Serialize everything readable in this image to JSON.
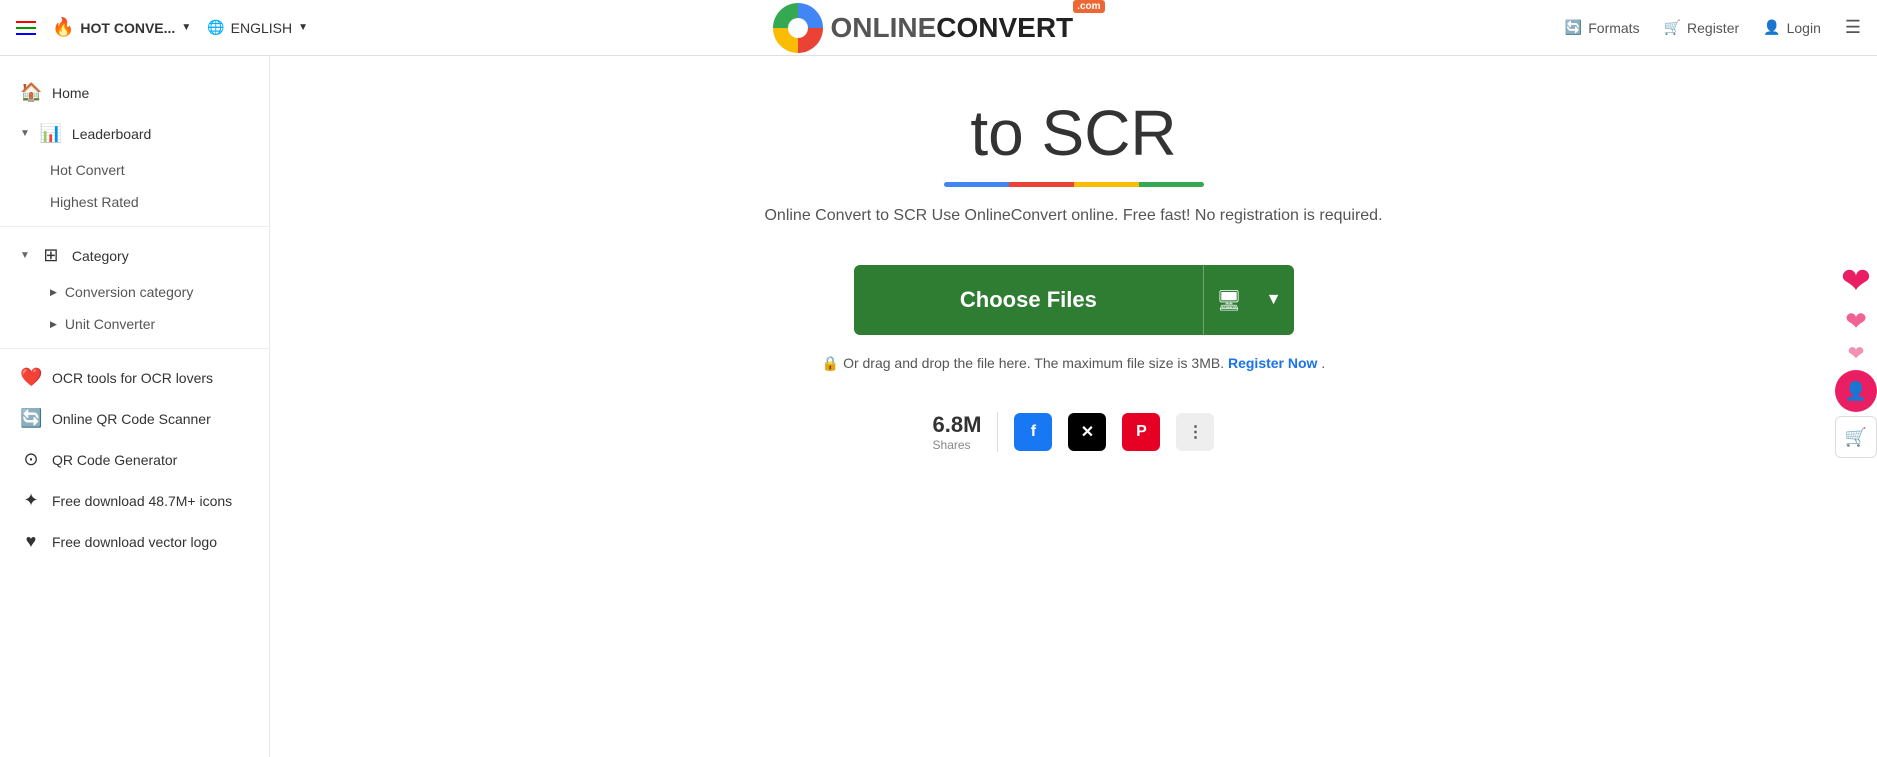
{
  "topnav": {
    "hot_convert_label": "HOT CONVE...",
    "lang_label": "ENGLISH",
    "formats_label": "Formats",
    "register_label": "Register",
    "login_label": "Login"
  },
  "logo": {
    "online": "ONLINE",
    "convert": "CONVERT",
    "com": ".com"
  },
  "sidebar": {
    "home_label": "Home",
    "leaderboard_label": "Leaderboard",
    "hot_convert_label": "Hot Convert",
    "highest_rated_label": "Highest Rated",
    "category_label": "Category",
    "conversion_category_label": "Conversion category",
    "unit_converter_label": "Unit Converter",
    "ocr_label": "OCR tools for OCR lovers",
    "qr_scanner_label": "Online QR Code Scanner",
    "qr_generator_label": "QR Code Generator",
    "icons_label": "Free download 48.7M+ icons",
    "vector_label": "Free download vector logo"
  },
  "main": {
    "title": "to SCR",
    "subtitle": "Online Convert to SCR Use OnlineConvert online. Free fast! No registration is required.",
    "choose_files_label": "Choose Files",
    "drag_drop_text": "Or drag and drop the file here. The maximum file size is 3MB.",
    "register_now_label": "Register Now",
    "shares_count": "6.8M",
    "shares_label": "Shares"
  }
}
